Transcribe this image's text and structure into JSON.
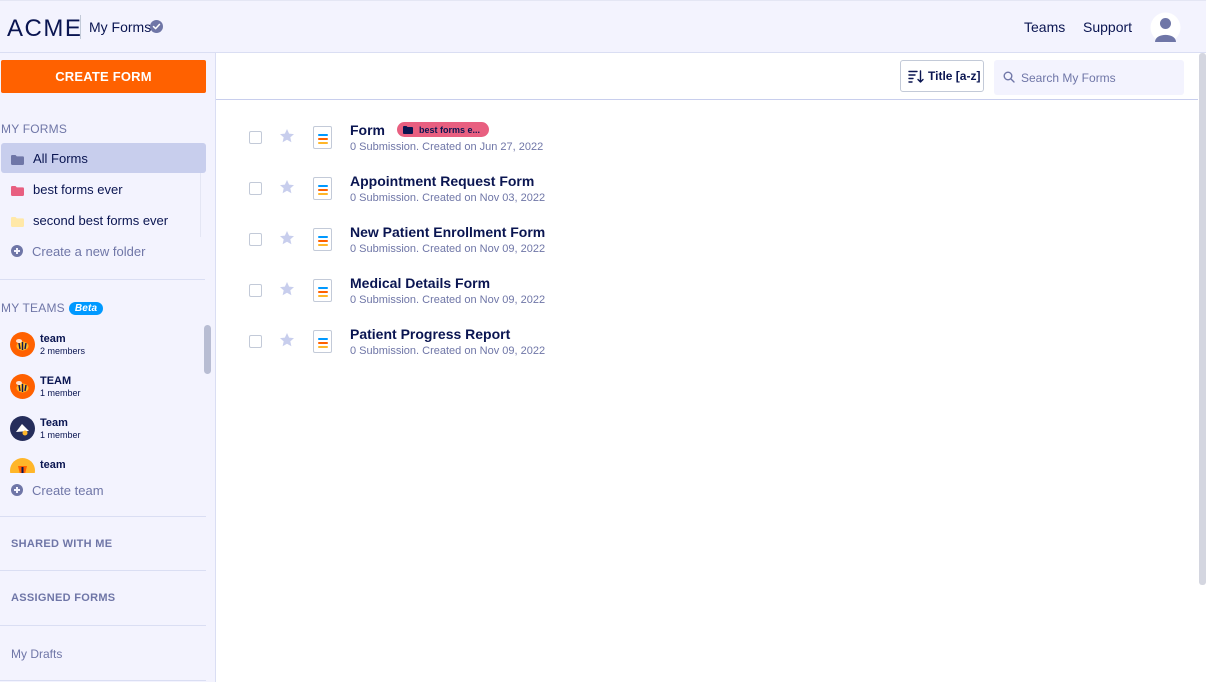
{
  "header": {
    "logo": "ACME",
    "section_title": "My Forms",
    "nav": {
      "teams": "Teams",
      "support": "Support"
    }
  },
  "sidebar": {
    "create_button": "CREATE FORM",
    "my_forms_label": "MY FORMS",
    "folders": [
      {
        "label": "All Forms",
        "color": "#6f76a7",
        "active": true
      },
      {
        "label": "best forms ever",
        "color": "#e85f80"
      },
      {
        "label": "second best forms ever",
        "color": "#ffe8a8"
      }
    ],
    "create_folder": "Create a new folder",
    "my_teams_label": "MY TEAMS",
    "beta_label": "Beta",
    "teams": [
      {
        "name": "team",
        "members": "2 members",
        "avatar_color": "#ff6100"
      },
      {
        "name": "TEAM",
        "members": "1 member",
        "avatar_color": "#ff6100"
      },
      {
        "name": "Team",
        "members": "1 member",
        "avatar_color": "#252d5b"
      },
      {
        "name": "team",
        "members": "",
        "avatar_color": "#ffb629"
      }
    ],
    "create_team": "Create team",
    "shared_with_me": "SHARED WITH ME",
    "assigned_forms": "ASSIGNED FORMS",
    "my_drafts": "My Drafts"
  },
  "toolbar": {
    "sort_label": "Title [a-z]",
    "search_placeholder": "Search My Forms"
  },
  "forms": [
    {
      "title": "Form",
      "meta": "0 Submission. Created on Jun 27, 2022",
      "tag": "best forms e..."
    },
    {
      "title": "Appointment Request Form",
      "meta": "0 Submission. Created on Nov 03, 2022"
    },
    {
      "title": "New Patient Enrollment Form",
      "meta": "0 Submission. Created on Nov 09, 2022"
    },
    {
      "title": "Medical Details Form",
      "meta": "0 Submission. Created on Nov 09, 2022"
    },
    {
      "title": "Patient Progress Report",
      "meta": "0 Submission. Created on Nov 09, 2022"
    }
  ],
  "colors": {
    "accent": "#ff6100",
    "navy": "#0a1551",
    "muted": "#6f76a7",
    "sidebar_bg": "#f3f3fe",
    "active_bg": "#c8ceed",
    "tag_pink": "#e85f80",
    "beta_blue": "#0099ff"
  }
}
